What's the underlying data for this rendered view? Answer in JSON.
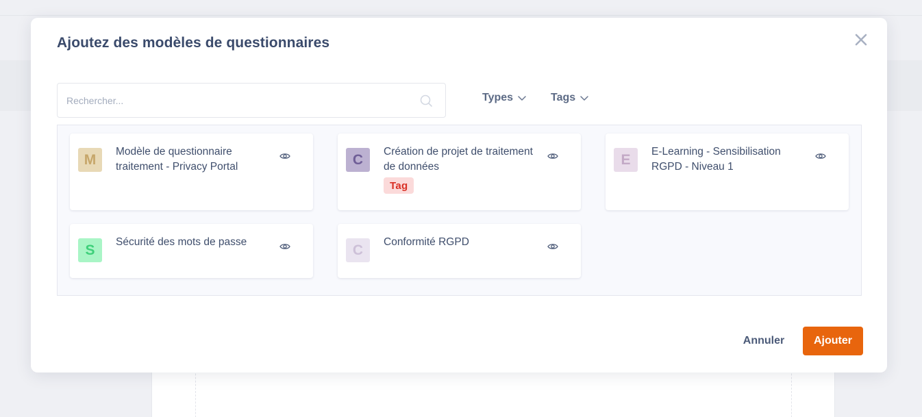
{
  "modal": {
    "title": "Ajoutez des modèles de questionnaires",
    "close_icon": "close-icon"
  },
  "search": {
    "placeholder": "Rechercher...",
    "value": "",
    "icon": "search-icon"
  },
  "filters": {
    "types_label": "Types",
    "tags_label": "Tags"
  },
  "templates": [
    {
      "initial": "M",
      "title": "Modèle de questionnaire traitement - Privacy Portal",
      "avatar_bg": "#e8d9b6",
      "avatar_fg": "#c6a66a",
      "tag": ""
    },
    {
      "initial": "C",
      "title": "Création de projet de traitement de données",
      "avatar_bg": "#bcb1d1",
      "avatar_fg": "#6f5e97",
      "tag": "Tag"
    },
    {
      "initial": "E",
      "title": "E-Learning - Sensibilisation RGPD - Niveau 1",
      "avatar_bg": "#e9dcea",
      "avatar_fg": "#c3a9c6",
      "tag": ""
    },
    {
      "initial": "S",
      "title": "Sécurité des mots de passe",
      "avatar_bg": "#a9f5c6",
      "avatar_fg": "#3ed07a",
      "tag": ""
    },
    {
      "initial": "C",
      "title": "Conformité RGPD",
      "avatar_bg": "#eae4f0",
      "avatar_fg": "#cdc0d8",
      "tag": ""
    }
  ],
  "footer": {
    "cancel_label": "Annuler",
    "add_label": "Ajouter"
  },
  "colors": {
    "accent": "#e8650d",
    "title": "#3a4a6b",
    "tag_bg": "#fbdada",
    "tag_fg": "#d93025"
  }
}
